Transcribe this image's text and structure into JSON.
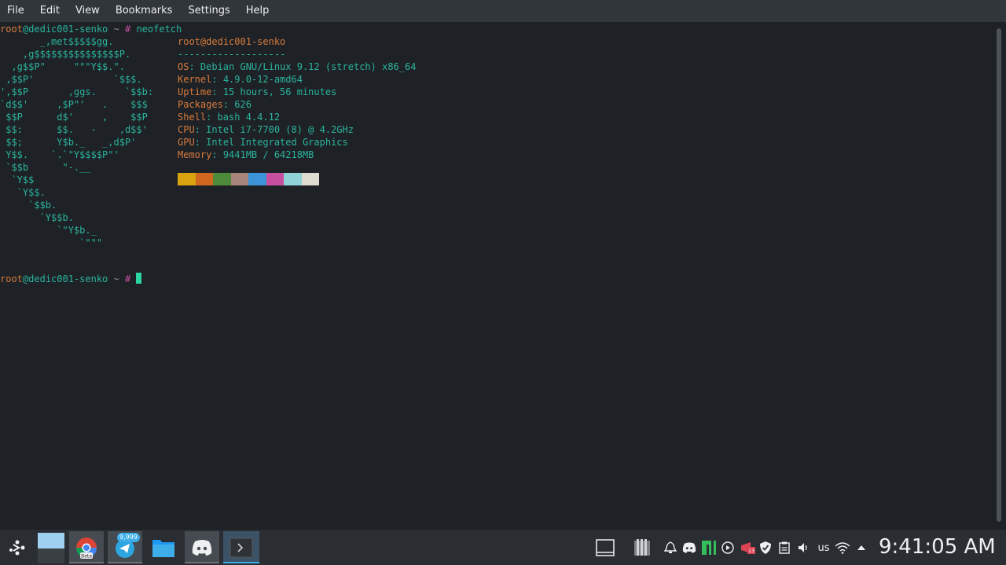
{
  "menubar": {
    "items": [
      "File",
      "Edit",
      "View",
      "Bookmarks",
      "Settings",
      "Help"
    ]
  },
  "terminal": {
    "prompt1": {
      "user": "root",
      "at": "@",
      "host": "dedic001-senko",
      "path": " ~ ",
      "hash": "#",
      "command": " neofetch"
    },
    "logo": [
      "       _,met$$$$$gg.",
      "    ,g$$$$$$$$$$$$$$$P.",
      "  ,g$$P\"     \"\"\"Y$$.\".",
      " ,$$P'              `$$$.",
      "',$$P       ,ggs.     `$$b:",
      "`d$$'     ,$P\"'   .    $$$",
      " $$P      d$'     ,    $$P",
      " $$:      $$.   -    ,d$$'",
      " $$;      Y$b._   _,d$P'",
      " Y$$.    `.`\"Y$$$$P\"'",
      " `$$b      \"-.__",
      "  `Y$$",
      "   `Y$$.",
      "     `$$b.",
      "       `Y$$b.",
      "          `\"Y$b._",
      "              `\"\"\""
    ],
    "info_title": {
      "user": "root",
      "at": "@",
      "host": "dedic001-senko"
    },
    "separator": "-------------------",
    "info": [
      {
        "key": "OS",
        "value": "Debian GNU/Linux 9.12 (stretch) x86_64"
      },
      {
        "key": "Kernel",
        "value": "4.9.0-12-amd64"
      },
      {
        "key": "Uptime",
        "value": "15 hours, 56 minutes"
      },
      {
        "key": "Packages",
        "value": "626"
      },
      {
        "key": "Shell",
        "value": "bash 4.4.12"
      },
      {
        "key": "CPU",
        "value": "Intel i7-7700 (8) @ 4.2GHz"
      },
      {
        "key": "GPU",
        "value": "Intel Integrated Graphics"
      },
      {
        "key": "Memory",
        "value": "9441MB / 64218MB"
      }
    ],
    "swatches": [
      "#d9a30f",
      "#d0671f",
      "#4d8a3a",
      "#a7857a",
      "#3b93d8",
      "#c64f9f",
      "#8fd3d8",
      "#dedbd0"
    ],
    "prompt2": {
      "user": "root",
      "at": "@",
      "host": "dedic001-senko",
      "path": " ~ ",
      "hash": "#"
    }
  },
  "taskbar": {
    "launcher_icon": "plasma-launcher-icon",
    "apps": [
      {
        "name": "desktop-pager",
        "icon": "desktop-pager-icon"
      },
      {
        "name": "chrome-beta",
        "icon": "chrome-beta-icon",
        "label": "Beta"
      },
      {
        "name": "telegram",
        "icon": "telegram-icon",
        "badge": "9,999"
      },
      {
        "name": "file-manager",
        "icon": "folder-icon"
      },
      {
        "name": "discord",
        "icon": "discord-icon"
      },
      {
        "name": "konsole",
        "icon": "terminal-icon"
      }
    ],
    "tray": {
      "keyboard_layout": "us",
      "clock": "9:41:05 AM"
    }
  }
}
